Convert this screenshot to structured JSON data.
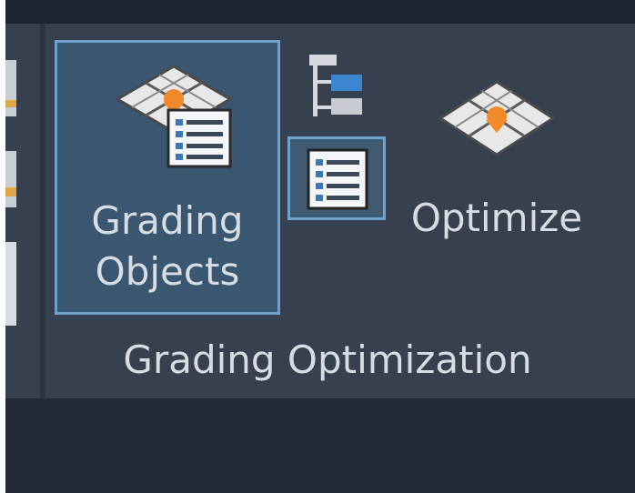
{
  "ribbon": {
    "panel_title": "Grading Optimization",
    "buttons": {
      "grading_objects": {
        "line1": "Grading",
        "line2": "Objects",
        "icon": "grading-objects-icon"
      },
      "optimize": {
        "label": "Optimize",
        "icon": "optimize-grid-icon"
      },
      "small_top": {
        "icon": "tree-structure-icon"
      },
      "small_list": {
        "icon": "list-panel-icon"
      }
    }
  },
  "colors": {
    "ribbon_bg": "#36404e",
    "active_border": "#6fa3cf",
    "active_fill": "#3a5670",
    "accent_orange": "#e07a2e",
    "text": "#d8dde3"
  }
}
